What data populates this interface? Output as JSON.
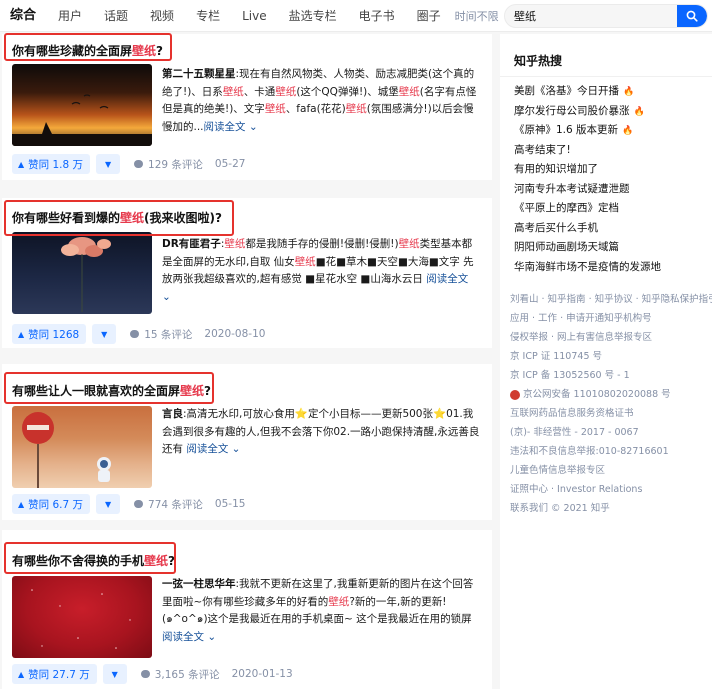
{
  "nav": {
    "tabs": [
      "综合",
      "用户",
      "话题",
      "视频",
      "专栏",
      "Live",
      "盐选专栏",
      "电子书",
      "圈子"
    ],
    "sort_label": "时间不限",
    "search_value": "壁纸"
  },
  "results": [
    {
      "title_pre": "你有哪些珍藏的全面屏",
      "title_hl": "壁纸",
      "title_post": "?",
      "author": "第二十五颗星星",
      "ex1": ":现在有自然风物类、人物类、励志减肥类(这个真的绝了!)、日系",
      "ex2": "、卡通",
      "ex3": "(这个QQ弹弹!)、城堡",
      "ex4": "(名字有点怪但是真的绝美!)、文字",
      "ex5": "、fafa(花花)",
      "ex6": "(氛围感满分!)以后会慢慢加的...",
      "more": "阅读全文 ⌄",
      "votes": "赞同 1.8 万",
      "comments": "129 条评论",
      "date": "05-27"
    },
    {
      "title_pre": "你有哪些好看到爆的",
      "title_hl": "壁纸",
      "title_post": "(我来收图啦)?",
      "author": "DR有匪君子",
      "ex1": ":",
      "ex2": "都是我随手存的侵删!侵删!侵删!)",
      "ex3": "类型基本都是全面屏的无水印,自取 仙女",
      "ex4": "■花■草木■天空■大海■文字 先放两张我超级喜欢的,超有感觉 ■星花水空 ■山海水云日",
      "more": "阅读全文 ⌄",
      "votes": "赞同 1268",
      "comments": "15 条评论",
      "date": "2020-08-10"
    },
    {
      "title_pre": "有哪些让人一眼就喜欢的全面屏",
      "title_hl": "壁纸",
      "title_post": "?",
      "author": "言良",
      "ex1": ":高清无水印,可放心食用⭐定个小目标——更新500张⭐01.我会遇到很多有趣的人,但我不会落下你02.一路小跑保持清醒,永远善良还有",
      "more": "阅读全文 ⌄",
      "votes": "赞同 6.7 万",
      "comments": "774 条评论",
      "date": "05-15"
    },
    {
      "title_pre": "有哪些你不舍得换的手机",
      "title_hl": "壁纸",
      "title_post": "?",
      "author": "一弦一柱思华年",
      "ex1": ":我就不更新在这里了,我重新更新的图片在这个回答里面啦~你有哪些珍藏多年的好看的",
      "ex2": "?新的一年,新的更新!(๑^o^๑)这个是我最近在用的手机桌面~ 这个是我最近在用的锁屏",
      "more": "阅读全文 ⌄",
      "votes": "赞同 27.7 万",
      "comments": "3,165 条评论",
      "date": "2020-01-13"
    }
  ],
  "hl_word": "壁纸",
  "sidebar": {
    "hot_title": "知乎热搜",
    "hot_items": [
      {
        "text": "美剧《洛基》今日开播",
        "fire": "🔥"
      },
      {
        "text": "摩尔发行母公司股价暴涨",
        "fire": "🔥"
      },
      {
        "text": "《原神》1.6 版本更新",
        "fire": "🔥"
      },
      {
        "text": "高考结束了!",
        "fire": ""
      },
      {
        "text": "有用的知识增加了",
        "fire": ""
      },
      {
        "text": "河南专升本考试疑遭泄题",
        "fire": ""
      },
      {
        "text": "《平原上的摩西》定档",
        "fire": ""
      },
      {
        "text": "高考后买什么手机",
        "fire": ""
      },
      {
        "text": "阴阳师动画剧场天域篇",
        "fire": ""
      },
      {
        "text": "华南海鲜市场不是疫情的发源地",
        "fire": ""
      }
    ],
    "footer": [
      "刘看山 · 知乎指南 · 知乎协议 · 知乎隐私保护指引",
      "应用 · 工作 · 申请开通知乎机构号",
      "侵权举报 · 网上有害信息举报专区",
      "京 ICP 证 110745 号",
      "京 ICP 备 13052560 号 - 1",
      "京公网安备 11010802020088 号",
      "互联网药品信息服务资格证书",
      "(京)- 非经营性 - 2017 - 0067",
      "违法和不良信息举报:010-82716601",
      "儿童色情信息举报专区",
      "证照中心 · Investor Relations",
      "联系我们 © 2021 知乎"
    ]
  },
  "colors": {
    "brand_blue": "#0a66ff",
    "highlight_red": "#e6394c",
    "annotation_red": "#e5322d",
    "muted": "#8590a6"
  }
}
